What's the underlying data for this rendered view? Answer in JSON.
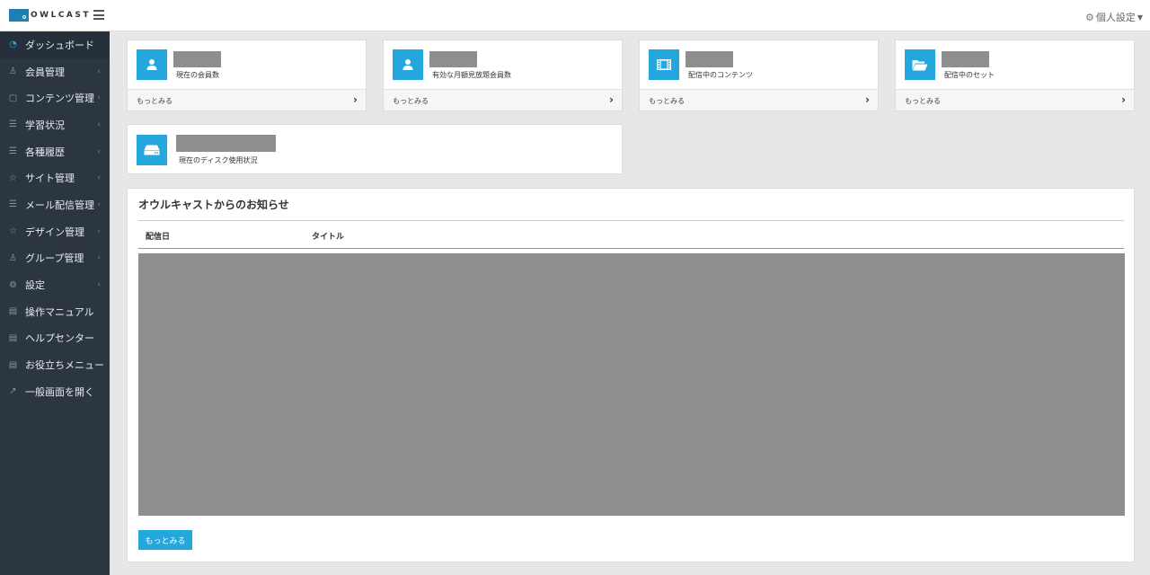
{
  "header": {
    "logo_text": "OWLCAST",
    "personal_settings": "個人設定"
  },
  "sidebar": {
    "items": [
      {
        "label": "ダッシュボード",
        "icon": "dashboard-icon",
        "active": true
      },
      {
        "label": "会員管理",
        "icon": "user-icon",
        "submenu": true
      },
      {
        "label": "コンテンツ管理",
        "icon": "file-icon",
        "submenu": true
      },
      {
        "label": "学習状況",
        "icon": "list-icon",
        "submenu": true
      },
      {
        "label": "各種履歴",
        "icon": "list-icon",
        "submenu": true
      },
      {
        "label": "サイト管理",
        "icon": "star-icon",
        "submenu": true
      },
      {
        "label": "メール配信管理",
        "icon": "list-icon",
        "submenu": true
      },
      {
        "label": "デザイン管理",
        "icon": "star-icon",
        "submenu": true
      },
      {
        "label": "グループ管理",
        "icon": "user-icon",
        "submenu": true
      },
      {
        "label": "設定",
        "icon": "gear-icon",
        "submenu": true
      },
      {
        "label": "操作マニュアル",
        "icon": "book-icon"
      },
      {
        "label": "ヘルプセンター",
        "icon": "book-icon"
      },
      {
        "label": "お役立ちメニュー",
        "icon": "book-icon"
      },
      {
        "label": "一般画面を開く",
        "icon": "external-link-icon"
      }
    ]
  },
  "stats": [
    {
      "label": "現在の会員数",
      "icon": "user-icon",
      "more": "もっとみる"
    },
    {
      "label": "有効な月額見放題会員数",
      "icon": "user-icon",
      "more": "もっとみる"
    },
    {
      "label": "配信中のコンテンツ",
      "icon": "film-icon",
      "more": "もっとみる"
    },
    {
      "label": "配信中のセット",
      "icon": "folder-open-icon",
      "more": "もっとみる"
    }
  ],
  "disk": {
    "label": "現在のディスク使用状況",
    "icon": "hard-drive-icon"
  },
  "news": {
    "title": "オウルキャストからのお知らせ",
    "columns": [
      "配信日",
      "タイトル"
    ],
    "more_button": "もっとみる"
  },
  "colors": {
    "accent": "#23a7dc",
    "sidebar_bg": "#2b3640",
    "redacted": "#8e8e8e"
  }
}
